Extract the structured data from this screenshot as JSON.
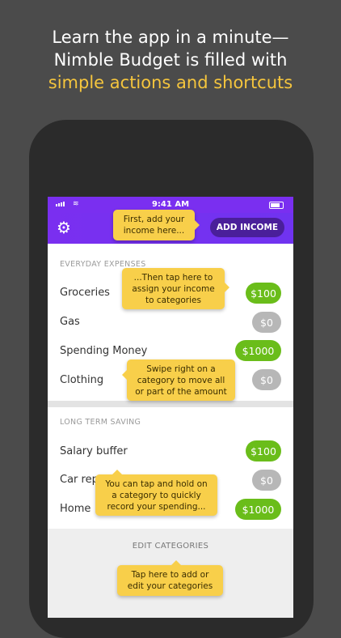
{
  "headline": {
    "line1": "Learn the app in a minute—",
    "line2": "Nimble Budget is filled with",
    "line3": "simple actions and shortcuts"
  },
  "status_bar": {
    "time": "9:41 AM"
  },
  "app_bar": {
    "add_income_label": "ADD INCOME",
    "settings_icon": "gear-icon"
  },
  "sections": {
    "everyday": {
      "title": "EVERYDAY EXPENSES",
      "items": [
        {
          "label": "Groceries",
          "amount": "$100",
          "status": "funded"
        },
        {
          "label": "Gas",
          "amount": "$0",
          "status": "empty"
        },
        {
          "label": "Spending Money",
          "amount": "$1000",
          "status": "funded"
        },
        {
          "label": "Clothing",
          "amount": "$0",
          "status": "empty"
        }
      ]
    },
    "long_term": {
      "title": "LONG TERM SAVING",
      "items": [
        {
          "label": "Salary buffer",
          "amount": "$100",
          "status": "funded"
        },
        {
          "label": "Car rep",
          "amount": "$0",
          "status": "empty"
        },
        {
          "label": "Home",
          "amount": "$1000",
          "status": "funded"
        }
      ]
    }
  },
  "edit_categories_label": "EDIT CATEGORIES",
  "callouts": {
    "add_income": "First, add your income here...",
    "assign": "...Then tap here to assign your income to categories",
    "swipe": "Swipe right on a category to move all or part of the amount",
    "hold": "You can tap and hold on a category to quickly record your spending...",
    "edit": "Tap here to add or edit your categories"
  },
  "colors": {
    "accent": "#7a2ff0",
    "funded": "#6abd1a",
    "empty": "#b7b7b7",
    "callout": "#f8cf4a",
    "highlight": "#f5c53d"
  }
}
